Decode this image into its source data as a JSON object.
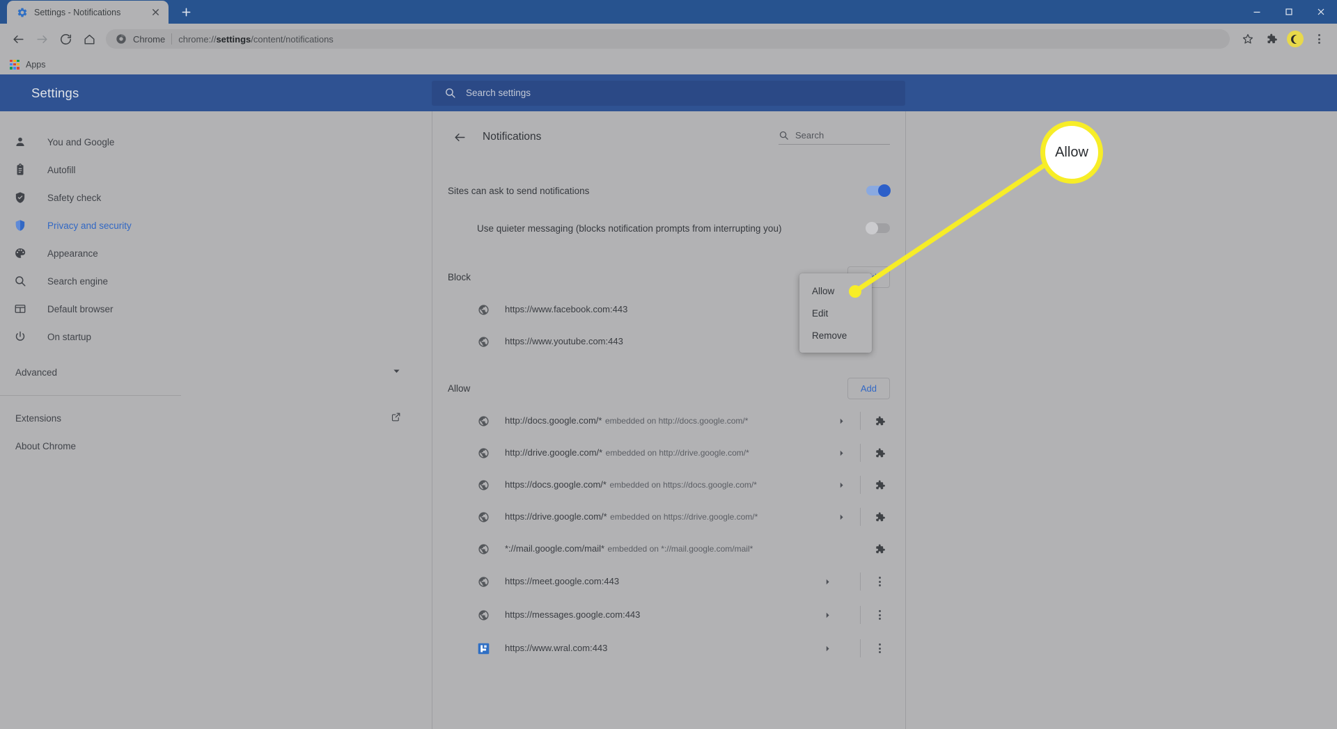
{
  "window": {
    "minimize_label": "Minimize",
    "maximize_label": "Maximize",
    "close_label": "Close"
  },
  "tab": {
    "title": "Settings - Notifications",
    "favicon": "gear-icon",
    "close_label": "Close tab",
    "newtab_label": "New tab"
  },
  "toolbar": {
    "back_label": "Back",
    "forward_label": "Forward",
    "reload_label": "Reload",
    "home_label": "Home",
    "chrome_chip": "Chrome",
    "url_prefix": "chrome://",
    "url_bold": "settings",
    "url_suffix": "/content/notifications",
    "url_full": "chrome://settings/content/notifications",
    "bookmark_label": "Bookmark this tab",
    "extensions_label": "Extensions",
    "profile_label": "Profile",
    "menu_label": "Customize and control Google Chrome"
  },
  "bookmarks_bar": {
    "apps_label": "Apps"
  },
  "settings": {
    "brand": "Settings",
    "search_placeholder": "Search settings",
    "sidebar": [
      {
        "label": "You and Google",
        "icon": "person-icon",
        "active": false
      },
      {
        "label": "Autofill",
        "icon": "clipboard-icon",
        "active": false
      },
      {
        "label": "Safety check",
        "icon": "shield-check-icon",
        "active": false
      },
      {
        "label": "Privacy and security",
        "icon": "shield-icon",
        "active": true
      },
      {
        "label": "Appearance",
        "icon": "palette-icon",
        "active": false
      },
      {
        "label": "Search engine",
        "icon": "search-icon",
        "active": false
      },
      {
        "label": "Default browser",
        "icon": "browser-window-icon",
        "active": false
      },
      {
        "label": "On startup",
        "icon": "power-icon",
        "active": false
      }
    ],
    "advanced_label": "Advanced",
    "extensions_label": "Extensions",
    "about_label": "About Chrome"
  },
  "content": {
    "title": "Notifications",
    "back_label": "Back",
    "search_placeholder": "Search",
    "toggles": [
      {
        "label": "Sites can ask to send notifications",
        "state": "on"
      },
      {
        "label": "Use quieter messaging (blocks notification prompts from interrupting you)",
        "state": "off"
      }
    ],
    "block_section": {
      "heading": "Block",
      "add_label": "Add",
      "sites": [
        {
          "url": "https://www.facebook.com:443",
          "sub": "",
          "favicon": "globe-icon",
          "chevron": false,
          "action": "none"
        },
        {
          "url": "https://www.youtube.com:443",
          "sub": "",
          "favicon": "globe-icon",
          "chevron": false,
          "action": "none"
        }
      ]
    },
    "allow_section": {
      "heading": "Allow",
      "add_label": "Add",
      "sites": [
        {
          "url": "http://docs.google.com/*",
          "sub": "embedded on http://docs.google.com/*",
          "favicon": "globe-icon",
          "chevron": true,
          "action": "puzzle-icon"
        },
        {
          "url": "http://drive.google.com/*",
          "sub": "embedded on http://drive.google.com/*",
          "favicon": "globe-icon",
          "chevron": true,
          "action": "puzzle-icon"
        },
        {
          "url": "https://docs.google.com/*",
          "sub": "embedded on https://docs.google.com/*",
          "favicon": "globe-icon",
          "chevron": true,
          "action": "puzzle-icon"
        },
        {
          "url": "https://drive.google.com/*",
          "sub": "embedded on https://drive.google.com/*",
          "favicon": "globe-icon",
          "chevron": true,
          "action": "puzzle-icon"
        },
        {
          "url": "*://mail.google.com/mail*",
          "sub": "embedded on *://mail.google.com/mail*",
          "favicon": "globe-icon",
          "chevron": false,
          "action": "puzzle-icon"
        },
        {
          "url": "https://meet.google.com:443",
          "sub": "",
          "favicon": "globe-icon",
          "chevron": true,
          "action": "more-vert-icon"
        },
        {
          "url": "https://messages.google.com:443",
          "sub": "",
          "favicon": "globe-icon",
          "chevron": true,
          "action": "more-vert-icon"
        },
        {
          "url": "https://www.wral.com:443",
          "sub": "",
          "favicon": "wral-icon",
          "chevron": true,
          "action": "more-vert-icon"
        }
      ]
    }
  },
  "context_menu": {
    "items": [
      {
        "label": "Allow"
      },
      {
        "label": "Edit"
      },
      {
        "label": "Remove"
      }
    ]
  },
  "annotation": {
    "callout_label": "Allow",
    "highlight_color": "#f7ed27",
    "target": "context-menu-item-allow"
  },
  "colors": {
    "browser_blue": "#27538f",
    "settings_blue": "#2f5292",
    "accent_blue": "#3268c4",
    "toggle_on": "#2c5fc9",
    "page_gray": "#b2b2b4",
    "annotation_yellow": "#f7ed27"
  }
}
